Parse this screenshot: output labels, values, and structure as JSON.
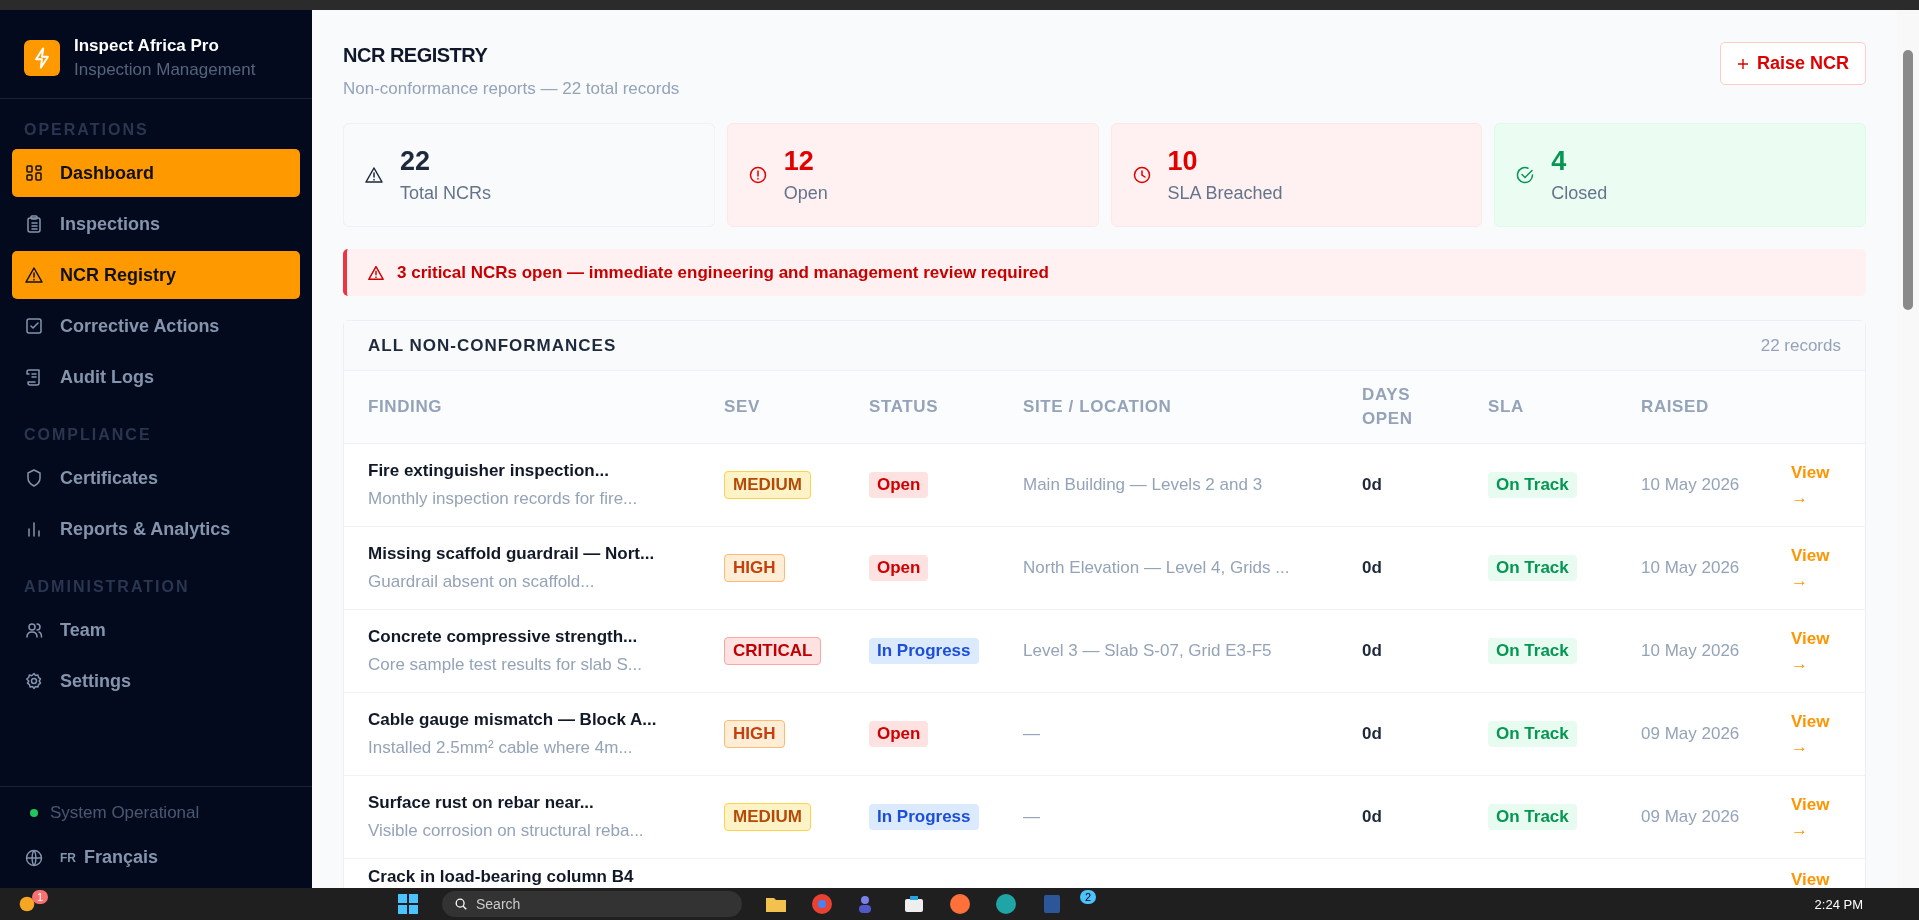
{
  "sidebar": {
    "brand": {
      "name": "Inspect Africa Pro",
      "tagline": "Inspection Management"
    },
    "sections": [
      {
        "heading": "OPERATIONS",
        "items": [
          {
            "label": "Dashboard",
            "selected": true
          },
          {
            "label": "Inspections",
            "selected": false
          },
          {
            "label": "NCR Registry",
            "selected": true
          },
          {
            "label": "Corrective Actions",
            "selected": false
          },
          {
            "label": "Audit Logs",
            "selected": false
          }
        ]
      },
      {
        "heading": "COMPLIANCE",
        "items": [
          {
            "label": "Certificates",
            "selected": false
          },
          {
            "label": "Reports & Analytics",
            "selected": false
          }
        ]
      },
      {
        "heading": "ADMINISTRATION",
        "items": [
          {
            "label": "Team",
            "selected": false
          },
          {
            "label": "Settings",
            "selected": false
          }
        ]
      }
    ],
    "status": "System Operational",
    "language": {
      "code": "FR",
      "label": "Français"
    }
  },
  "header": {
    "title": "NCR REGISTRY",
    "subtitle": "Non-conformance reports — 22 total records",
    "button": "Raise NCR"
  },
  "stats": [
    {
      "value": "22",
      "label": "Total NCRs",
      "kind": "neutral"
    },
    {
      "value": "12",
      "label": "Open",
      "kind": "open"
    },
    {
      "value": "10",
      "label": "SLA Breached",
      "kind": "breached"
    },
    {
      "value": "4",
      "label": "Closed",
      "kind": "closed"
    }
  ],
  "alert": "3 critical NCRs open — immediate engineering and management review required",
  "table": {
    "title": "ALL NON-CONFORMANCES",
    "count": "22 records",
    "columns": [
      "FINDING",
      "SEV",
      "STATUS",
      "SITE / LOCATION",
      "DAYS OPEN",
      "SLA",
      "RAISED"
    ],
    "rows": [
      {
        "title": "Fire extinguisher inspection...",
        "description": "Monthly inspection records for fire...",
        "severity": {
          "label": "MEDIUM",
          "kind": "medium"
        },
        "status": {
          "label": "Open",
          "kind": "open"
        },
        "site": "Main Building — Levels 2 and 3",
        "days": "0d",
        "sla": {
          "label": "On Track",
          "kind": "on_track"
        },
        "raised": "10 May 2026",
        "action": "View →"
      },
      {
        "title": "Missing scaffold guardrail — Nort...",
        "description": "Guardrail absent on scaffold...",
        "severity": {
          "label": "HIGH",
          "kind": "high"
        },
        "status": {
          "label": "Open",
          "kind": "open"
        },
        "site": "North Elevation — Level 4, Grids ...",
        "days": "0d",
        "sla": {
          "label": "On Track",
          "kind": "on_track"
        },
        "raised": "10 May 2026",
        "action": "View →"
      },
      {
        "title": "Concrete compressive strength...",
        "description": "Core sample test results for slab S...",
        "severity": {
          "label": "CRITICAL",
          "kind": "critical"
        },
        "status": {
          "label": "In Progress",
          "kind": "in_progress"
        },
        "site": "Level 3 — Slab S-07, Grid E3-F5",
        "days": "0d",
        "sla": {
          "label": "On Track",
          "kind": "on_track"
        },
        "raised": "10 May 2026",
        "action": "View →"
      },
      {
        "title": "Cable gauge mismatch — Block A...",
        "description": "Installed 2.5mm² cable where 4m...",
        "severity": {
          "label": "HIGH",
          "kind": "high"
        },
        "status": {
          "label": "Open",
          "kind": "open"
        },
        "site": "—",
        "days": "0d",
        "sla": {
          "label": "On Track",
          "kind": "on_track"
        },
        "raised": "09 May 2026",
        "action": "View →"
      },
      {
        "title": "Surface rust on rebar near...",
        "description": "Visible corrosion on structural reba...",
        "severity": {
          "label": "MEDIUM",
          "kind": "medium"
        },
        "status": {
          "label": "In Progress",
          "kind": "in_progress"
        },
        "site": "—",
        "days": "0d",
        "sla": {
          "label": "On Track",
          "kind": "on_track"
        },
        "raised": "09 May 2026",
        "action": "View →"
      },
      {
        "title": "Crack in load-bearing column B4",
        "action": "View"
      }
    ]
  },
  "taskbar": {
    "notifications": "1",
    "search": {
      "placeholder": "Search"
    },
    "app_badge": "2",
    "time": "2:24 PM"
  }
}
